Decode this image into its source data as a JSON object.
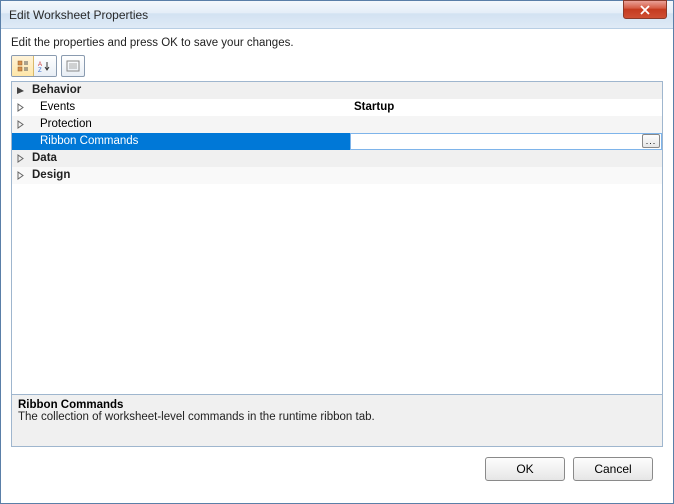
{
  "window": {
    "title": "Edit Worksheet Properties"
  },
  "instruction": "Edit the properties and press OK to save your changes.",
  "grid": {
    "categories": [
      {
        "name": "Behavior",
        "expanded": true,
        "rows": [
          {
            "name": "Events",
            "value": "Startup",
            "has_children": true
          },
          {
            "name": "Protection",
            "value": "",
            "has_children": true
          },
          {
            "name": "Ribbon Commands",
            "value": "",
            "has_children": false,
            "selected": true,
            "has_dialog": true
          }
        ]
      },
      {
        "name": "Data",
        "expanded": false,
        "rows": []
      },
      {
        "name": "Design",
        "expanded": false,
        "rows": []
      }
    ]
  },
  "description": {
    "title": "Ribbon Commands",
    "text": "The collection of worksheet-level commands in the runtime ribbon tab."
  },
  "buttons": {
    "ok": "OK",
    "cancel": "Cancel"
  },
  "ellipsis": "..."
}
